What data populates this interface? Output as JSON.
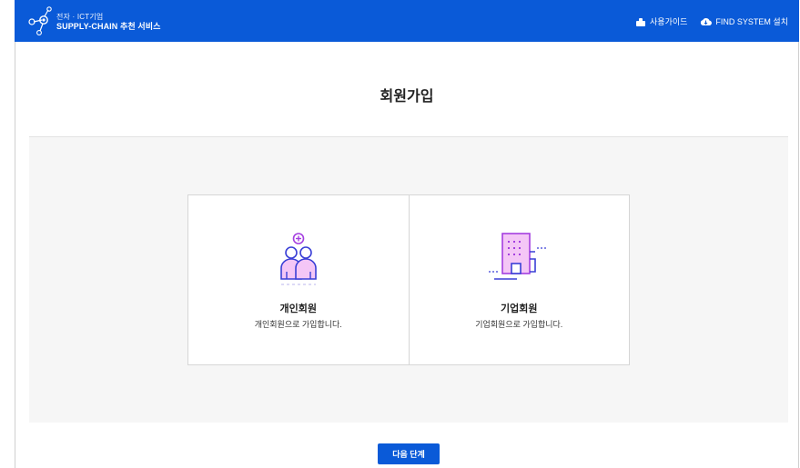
{
  "header": {
    "brand_small": "전자 · ICT기업",
    "brand_big": "SUPPLY-CHAIN 추천 서비스",
    "links": [
      {
        "label": "사용가이드",
        "icon": "guide-icon"
      },
      {
        "label": "FIND SYSTEM 설치",
        "icon": "cloud-download-icon"
      }
    ]
  },
  "page": {
    "title": "회원가입"
  },
  "options": [
    {
      "title": "개인회원",
      "desc": "개인회원으로 가입합니다.",
      "icon": "users-plus-icon"
    },
    {
      "title": "기업회원",
      "desc": "기업회원으로 가입합니다.",
      "icon": "building-icon"
    }
  ],
  "actions": {
    "next_label": "다음 단계"
  },
  "colors": {
    "primary": "#0a5ad8",
    "icon_blue": "#3a3fd6",
    "icon_purple": "#a43ee0",
    "icon_fill": "#f4c6f6",
    "panel_bg": "#f6f6f6"
  }
}
